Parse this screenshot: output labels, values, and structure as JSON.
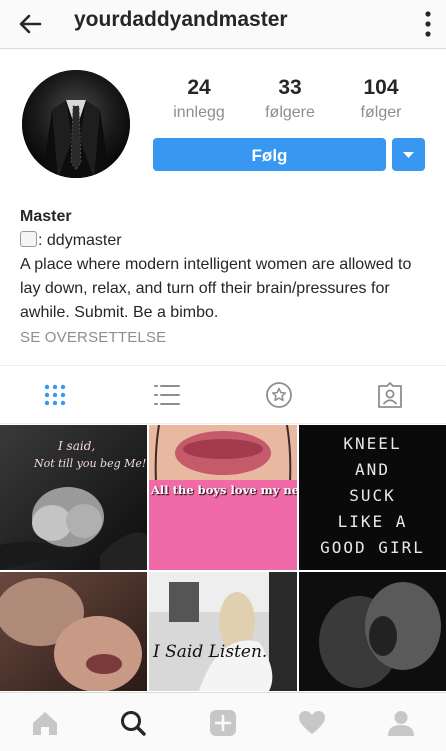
{
  "header": {
    "username": "yourdaddyandmaster"
  },
  "stats": [
    {
      "value": "24",
      "label": "innlegg"
    },
    {
      "value": "33",
      "label": "følgere"
    },
    {
      "value": "104",
      "label": "følger"
    }
  ],
  "actions": {
    "follow_label": "Følg"
  },
  "bio": {
    "name": "Master",
    "handle_text": ": ddymaster",
    "description": "A place where modern intelligent women are allowed to lay down, relax, and turn off their brain/pressures for awhile. Submit. Be a bimbo.",
    "translate_label": "SE OVERSETTELSE"
  },
  "posts": [
    {
      "caption_line1": "I said,",
      "caption_line2": "Not till you beg Me!"
    },
    {
      "caption": "All the boys love my new lips!"
    },
    {
      "caption_lines": [
        "KNEEL",
        "AND",
        "SUCK",
        "LIKE A",
        "GOOD GIRL"
      ]
    },
    {
      "caption": ""
    },
    {
      "caption": "I Said Listen."
    },
    {
      "caption": ""
    }
  ],
  "colors": {
    "accent": "#3897f0",
    "muted": "#8e8e8e",
    "text": "#262626"
  },
  "icons": {
    "header": [
      "back-arrow-icon",
      "more-options-icon"
    ],
    "tabs": [
      "grid-view-icon",
      "list-view-icon",
      "star-icon",
      "tagged-photos-icon"
    ],
    "bottom_nav": [
      "home-icon",
      "search-icon",
      "add-post-icon",
      "heart-icon",
      "profile-icon"
    ]
  }
}
